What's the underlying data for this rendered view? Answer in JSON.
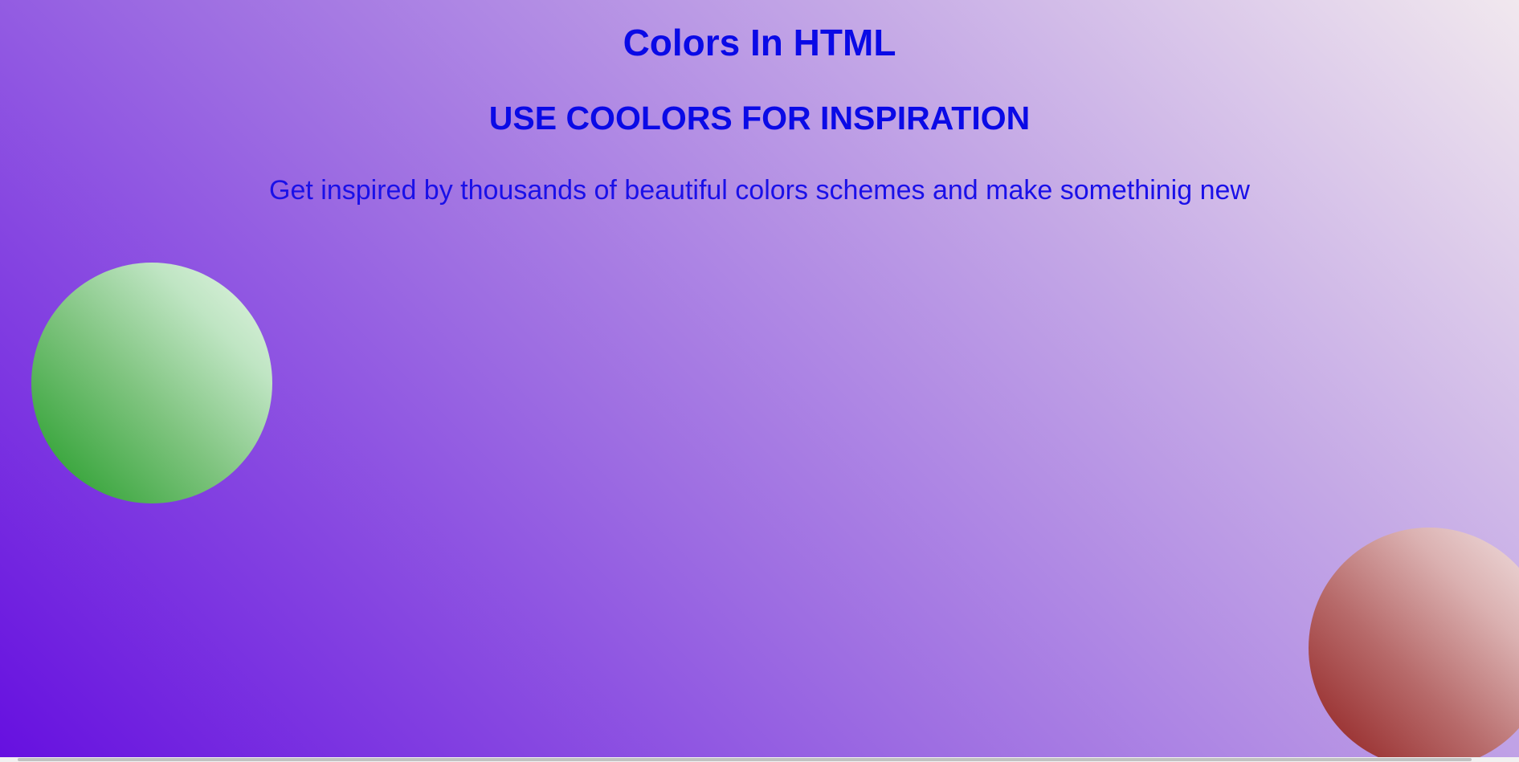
{
  "page": {
    "title": "Colors In HTML",
    "subtitle": "USE COOLORS FOR INSPIRATION",
    "tagline": "Get inspired by thousands of beautiful colors schemes and make somethinig new"
  },
  "colors": {
    "text": "#0a0ae6",
    "background_start": "#6610e0",
    "background_end": "#f1e8ee",
    "green_circle": "#1f9a24",
    "red_circle": "#8e1a1a"
  }
}
